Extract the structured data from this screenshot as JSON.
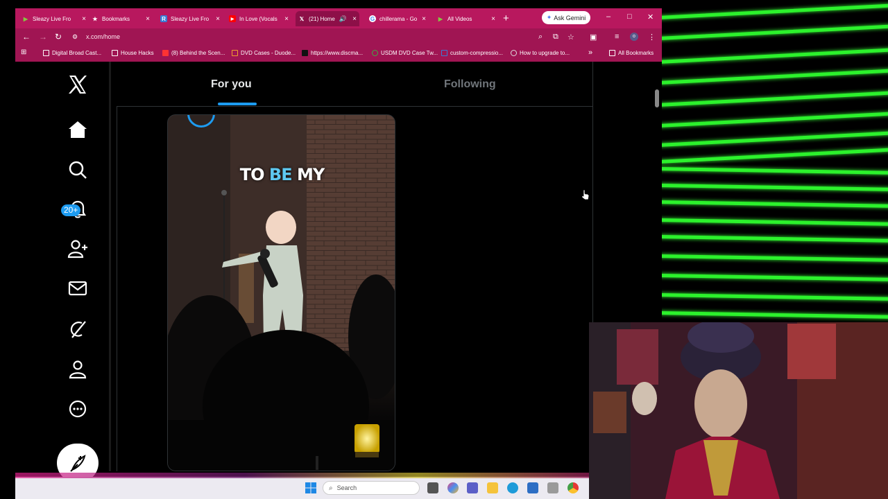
{
  "browser": {
    "tabs": [
      {
        "label": "Sleazy Live Fro",
        "favicon": "rumble-icon",
        "color": "#85c742"
      },
      {
        "label": "Bookmarks",
        "favicon": "star-icon",
        "color": "#ffffff"
      },
      {
        "label": "Sleazy Live Fro",
        "favicon": "r-icon",
        "color": "#3a7bd5"
      },
      {
        "label": "In Love (Vocals",
        "favicon": "youtube-icon",
        "color": "#ff0000"
      },
      {
        "label": "(21) Home",
        "favicon": "x-icon",
        "color": "#000000"
      },
      {
        "label": "chillerama - Go",
        "favicon": "google-icon",
        "color": "#ffffff"
      },
      {
        "label": "All Videos",
        "favicon": "rumble-icon",
        "color": "#85c742"
      }
    ],
    "new_tab": "+",
    "gemini_label": "Ask Gemini",
    "window_controls": {
      "minimize": "–",
      "maximize": "□",
      "close": "✕"
    },
    "url": "x.com/home",
    "bookmarks": [
      "Digital Broad Cast...",
      "House Hacks",
      "(8) Behind the Scen...",
      "DVD Cases - Duode...",
      "https://www.discma...",
      "USDM DVD Case Tw...",
      "custom-compressio...",
      "How to upgrade to..."
    ],
    "bookmarks_more": "»",
    "all_bookmarks": "All Bookmarks",
    "theme_color": "#b8185e"
  },
  "x_app": {
    "nav": [
      "x-logo-icon",
      "home-icon",
      "search-icon",
      "notifications-icon",
      "follow-icon",
      "messages-icon",
      "grok-icon",
      "profile-icon",
      "more-icon"
    ],
    "notifications_badge": "20+",
    "feed_tabs": {
      "for_you": "For you",
      "following": "Following"
    },
    "active_tab": "For you",
    "video_caption": {
      "part1": "TO ",
      "highlight": "BE",
      "part2": " MY"
    },
    "accent": "#1d9bf0"
  },
  "taskbar": {
    "search_placeholder": "Search"
  }
}
